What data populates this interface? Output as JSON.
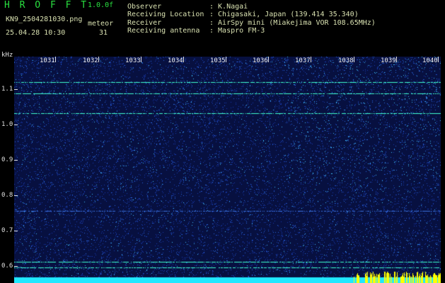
{
  "header": {
    "title": "H R O F F T",
    "version": "1.0.0f",
    "filename": "KN9_2504281030.png",
    "mode": "meteor",
    "datetime": "25.04.28 10:30",
    "count": "31",
    "fields": [
      {
        "label": "Observer",
        "value": ": K.Nagai"
      },
      {
        "label": "Receiving Location",
        "value": ": Chigasaki, Japan (139.414 35.340)"
      },
      {
        "label": "Receiver",
        "value": ": AirSpy mini (Miakejima VOR 108.65MHz)"
      },
      {
        "label": "Receiving antenna",
        "value": ": Maspro FM-3"
      }
    ]
  },
  "plot": {
    "unit": "kHz",
    "y_labels": [
      "1.1",
      "1.0",
      "0.9",
      "0.8",
      "0.7",
      "0.6"
    ],
    "x_labels": [
      "1031",
      "1032",
      "1033",
      "1034",
      "1035",
      "1036",
      "1037",
      "1038",
      "1039",
      "1040"
    ],
    "colors": {
      "background": "#071040",
      "noise": "#1a40c0",
      "bright": "#40c0ff",
      "line": "#40ffd0",
      "bottom": "#20e8ff",
      "marker": "#ffff00"
    }
  }
}
